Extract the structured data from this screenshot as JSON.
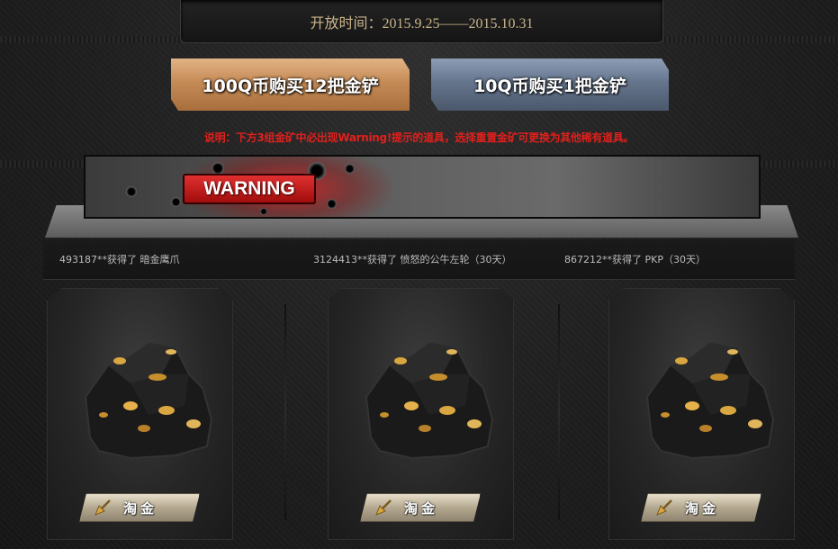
{
  "header": {
    "open_time": "开放时间：2015.9.25——2015.10.31"
  },
  "buttons": {
    "buy_12": "100Q币购买12把金铲",
    "buy_1": "10Q币购买1把金铲"
  },
  "note": "说明：下方3组金矿中必出现Warning!提示的道具，选择重置金矿可更换为其他稀有道具。",
  "banner": {
    "warning_label": "WARNING"
  },
  "ticker": {
    "items": [
      "493187**获得了 暗金鹰爪",
      "3124413**获得了 愤怒的公牛左轮（30天）",
      "867212**获得了 PKP（30天）"
    ]
  },
  "cards": [
    {
      "button_label": "淘金",
      "icon": "golden-shovel-icon",
      "image": "gold-ore-rock"
    },
    {
      "button_label": "淘金",
      "icon": "golden-shovel-icon",
      "image": "gold-ore-rock"
    },
    {
      "button_label": "淘金",
      "icon": "golden-shovel-icon",
      "image": "gold-ore-rock"
    }
  ],
  "colors": {
    "accent_gold": "#c9b48a",
    "note_red": "#e0201c",
    "button_copper": "#c58b57",
    "button_steel": "#65758d",
    "warning_red": "#d42020"
  }
}
